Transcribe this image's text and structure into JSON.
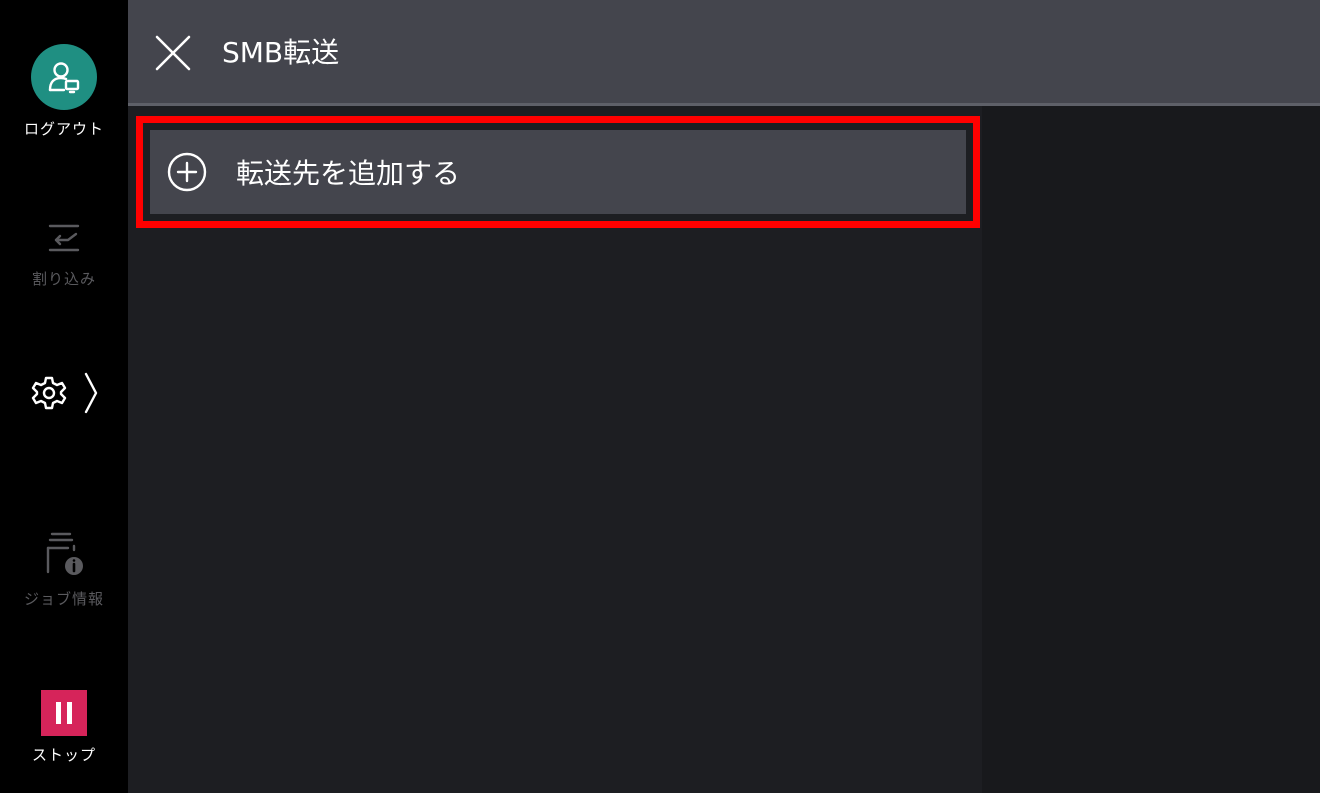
{
  "rail": {
    "logout_label": "ログアウト",
    "interrupt_label": "割り込み",
    "job_info_label": "ジョブ情報",
    "stop_label": "ストップ"
  },
  "header": {
    "title": "SMB転送"
  },
  "list": {
    "add_destination_label": "転送先を追加する"
  },
  "icons": {
    "logout": "user-monitor-icon",
    "interrupt": "interrupt-icon",
    "settings": "gear-icon",
    "expand": "chevron-right-icon",
    "job_info": "job-info-icon",
    "stop": "pause-icon",
    "close": "close-icon",
    "add": "plus-circle-icon"
  },
  "colors": {
    "logout_accent": "#1f8f82",
    "stop_accent": "#d6245a",
    "highlight": "#ff0000",
    "header_bg": "#44454d"
  }
}
